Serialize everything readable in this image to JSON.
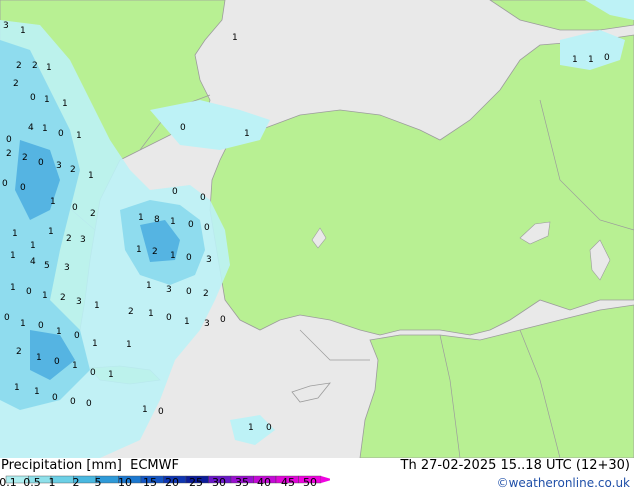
{
  "footer": {
    "title_left": "Precipitation [mm]  ECMWF",
    "title_right": "Th 27-02-2025 15..18 UTC (12+30)",
    "credit": "©weatheronline.co.uk"
  },
  "colorbar": {
    "levels": [
      "0.1",
      "0.5",
      "1",
      "2",
      "5",
      "10",
      "15",
      "20",
      "25",
      "30",
      "35",
      "40",
      "45",
      "50"
    ],
    "colors": [
      "#aeeef0",
      "#8ee0ea",
      "#6cd0e6",
      "#4ab8e0",
      "#2f9ad8",
      "#1c78d0",
      "#1456c4",
      "#0f36b2",
      "#0c1c98",
      "#6a18c8",
      "#9a10d0",
      "#c40ad6",
      "#e006d8",
      "#f004e0"
    ]
  },
  "colors": {
    "land": "#b8f093",
    "sea": "#e9e9e9",
    "precip_light": "#bdf2f6",
    "precip_mid": "#8fdcee",
    "precip_heavy": "#55b4e2",
    "border": "#9c9c9c"
  },
  "map_values": [
    "3",
    "1",
    "2",
    "2",
    "1",
    "2",
    "0",
    "1",
    "1",
    "4",
    "0",
    "1",
    "0",
    "1",
    "2",
    "2",
    "0",
    "3",
    "2",
    "1",
    "0",
    "0",
    "1",
    "0",
    "2",
    "1",
    "8",
    "1",
    "0",
    "0",
    "1",
    "1",
    "1",
    "2",
    "3",
    "1",
    "2",
    "1",
    "0",
    "3",
    "1",
    "4",
    "5",
    "3",
    "1",
    "0",
    "1",
    "2",
    "3",
    "1",
    "1",
    "3",
    "0",
    "2",
    "0",
    "1",
    "0",
    "1",
    "0",
    "1",
    "2",
    "1",
    "0",
    "1",
    "3",
    "2",
    "1",
    "0",
    "1",
    "0",
    "1",
    "1",
    "1",
    "1",
    "0",
    "0",
    "0",
    "1",
    "0",
    "1",
    "0",
    "0",
    "1",
    "1",
    "1",
    "1",
    "0",
    "0",
    "0",
    "0"
  ]
}
